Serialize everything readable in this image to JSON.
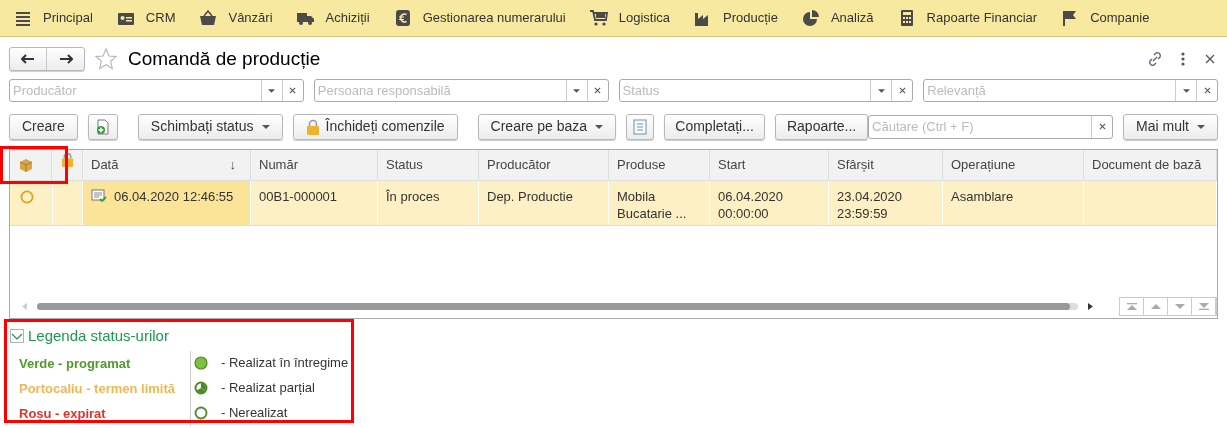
{
  "nav": [
    {
      "label": "Principal"
    },
    {
      "label": "CRM"
    },
    {
      "label": "Vânzări"
    },
    {
      "label": "Achiziții"
    },
    {
      "label": "Gestionarea numerarului"
    },
    {
      "label": "Logistica"
    },
    {
      "label": "Producție"
    },
    {
      "label": "Analiză"
    },
    {
      "label": "Rapoarte Financiar"
    },
    {
      "label": "Companie"
    }
  ],
  "title": "Comandă de producție",
  "filters": [
    {
      "placeholder": "Producător"
    },
    {
      "placeholder": "Persoana responsabilă"
    },
    {
      "placeholder": "Status"
    },
    {
      "placeholder": "Relevanță"
    }
  ],
  "toolbar": {
    "create": "Creare",
    "change_status": "Schimbați status",
    "close_orders": "Închideți comenzile",
    "create_based": "Creare pe baza",
    "complete": "Completați...",
    "reports": "Rapoarte...",
    "search_placeholder": "Căutare (Ctrl + F)",
    "more": "Mai mult"
  },
  "table": {
    "columns": [
      "Dată",
      "Număr",
      "Status",
      "Producător",
      "Produse",
      "Start",
      "Sfârșit",
      "Operațiune",
      "Document de bază"
    ],
    "sort_arrow": "↓",
    "rows": [
      {
        "selected": true,
        "color": "#e8a020",
        "cells": [
          "06.04.2020 12:46:55",
          "00B1-000001",
          "În proces",
          "Dep. Productie",
          "Mobila Bucatarie ...",
          "06.04.2020 00:00:00",
          "23.04.2020 23:59:59",
          "Asamblare",
          ""
        ]
      }
    ]
  },
  "legend": {
    "title": "Legenda status-urilor",
    "expanded": true,
    "colors": [
      {
        "label": "Verde - programat",
        "color": "#4f9a2a"
      },
      {
        "label": "Portocaliu - termen limită",
        "color": "#f3b74f"
      },
      {
        "label": "Roșu - expirat",
        "color": "#e0342a"
      }
    ],
    "states": [
      {
        "kind": "full",
        "label": "- Realizat în întregime"
      },
      {
        "kind": "partial",
        "label": "- Realizat parțial"
      },
      {
        "kind": "empty",
        "label": "- Nerealizat"
      }
    ]
  }
}
